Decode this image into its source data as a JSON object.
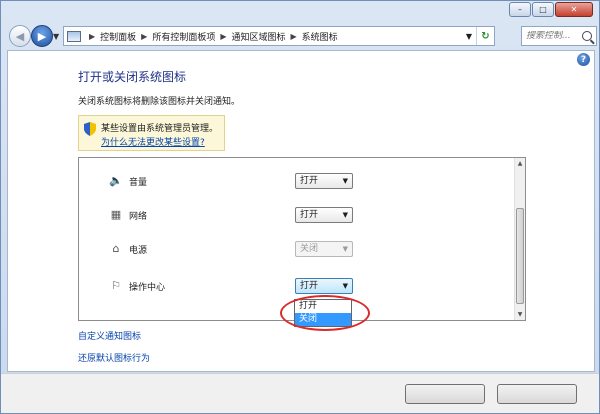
{
  "window": {
    "minimize": "–",
    "maximize": "□",
    "close": "✕"
  },
  "breadcrumb": [
    "控制面板",
    "所有控制面板项",
    "通知区域图标",
    "系统图标"
  ],
  "search": {
    "placeholder": "搜索控制..."
  },
  "page": {
    "title": "打开或关闭系统图标",
    "description": "关闭系统图标将删除该图标并关闭通知。",
    "admin_note": "某些设置由系统管理员管理。",
    "admin_link": "为什么无法更改某些设置?"
  },
  "icons_list": {
    "rows": [
      {
        "icon": "volume-icon",
        "label": "音量",
        "value": "打开",
        "disabled": false
      },
      {
        "icon": "network-icon",
        "label": "网络",
        "value": "打开",
        "disabled": false
      },
      {
        "icon": "power-icon",
        "label": "电源",
        "value": "关闭",
        "disabled": true
      },
      {
        "icon": "flag-icon",
        "label": "操作中心",
        "value": "打开",
        "disabled": false
      }
    ],
    "dropdown_options": [
      "打开",
      "关闭"
    ],
    "dropdown_selected": "关闭"
  },
  "links": {
    "customize": "自定义通知图标",
    "restore": "还原默认图标行为"
  }
}
